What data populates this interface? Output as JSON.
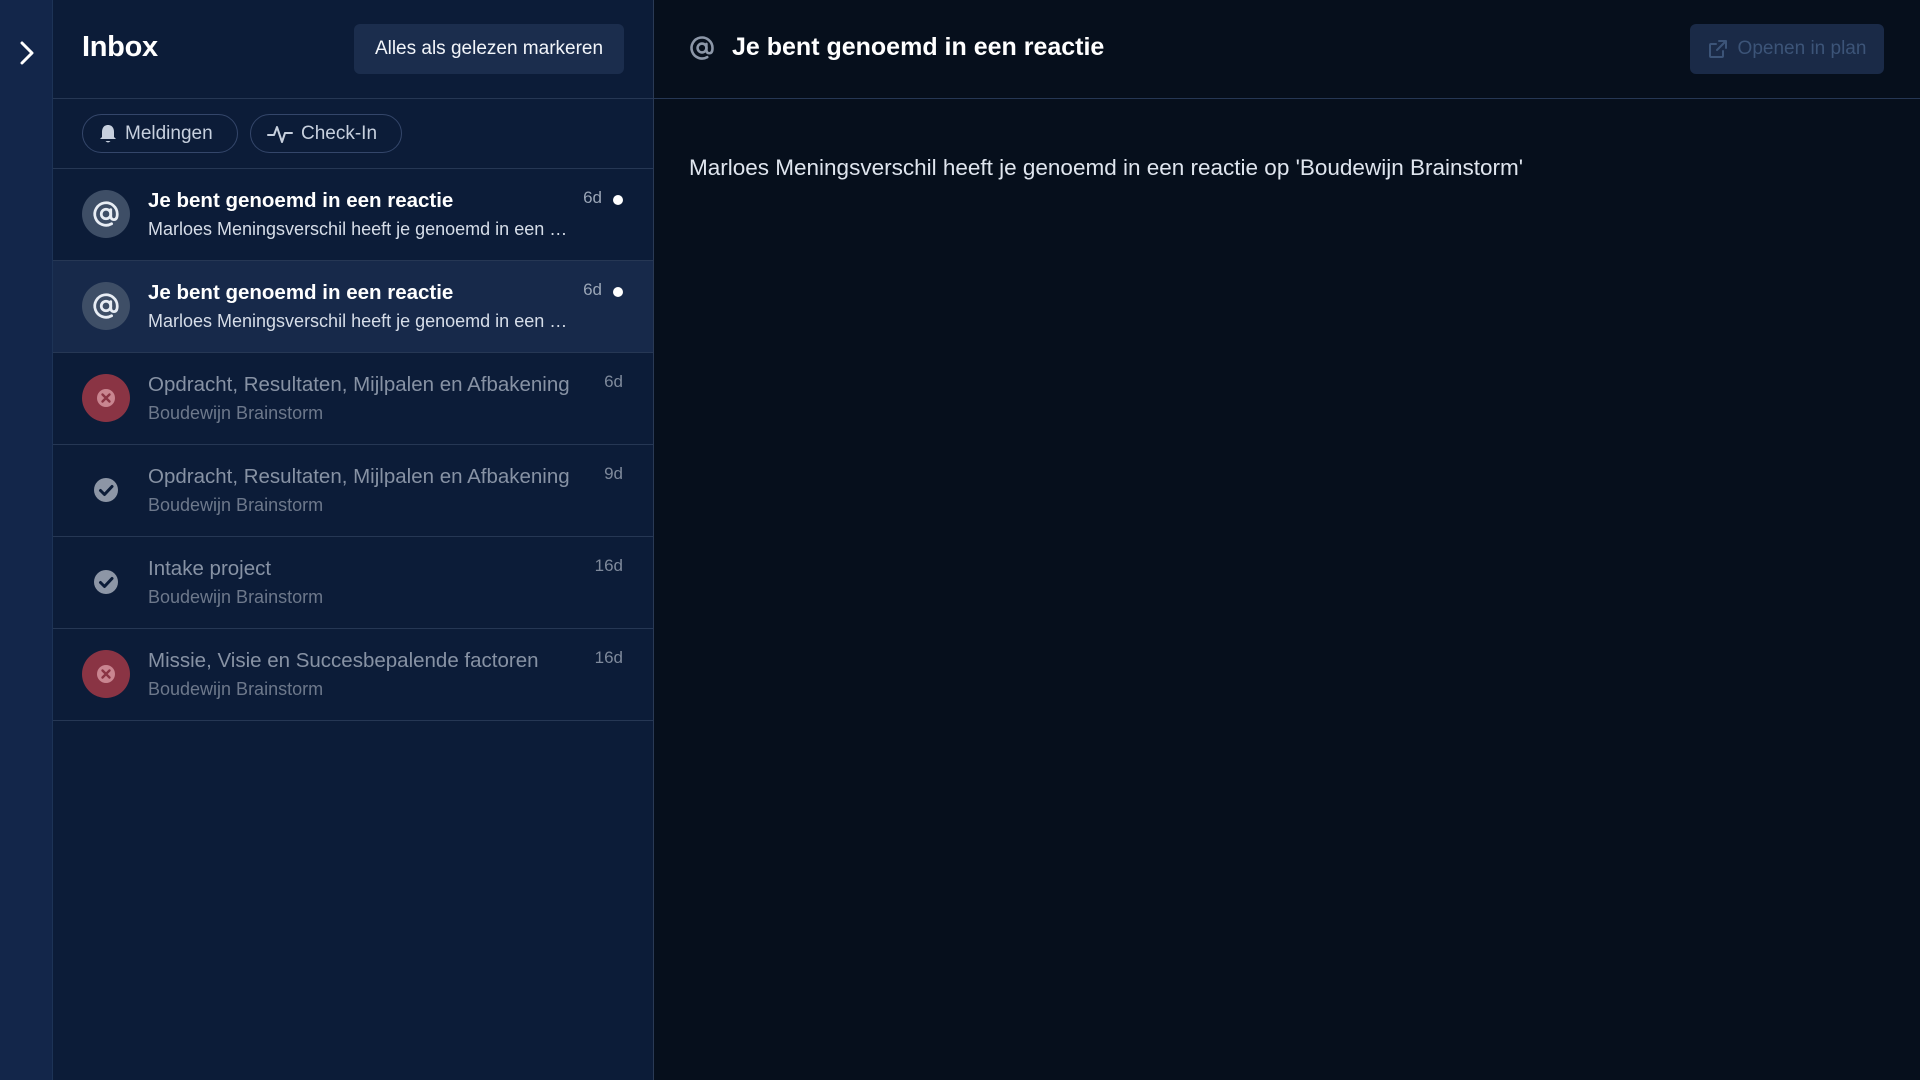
{
  "rail": {
    "toggle_icon": "chevron-right-icon"
  },
  "inbox": {
    "title": "Inbox",
    "mark_all_label": "Alles als gelezen markeren",
    "filters": [
      {
        "label": "Meldingen",
        "icon": "bell-icon"
      },
      {
        "label": "Check-In",
        "icon": "pulse-icon"
      }
    ],
    "items": [
      {
        "kind": "mention",
        "icon": "at-sign-icon",
        "title": "Je bent genoemd in een reactie",
        "subtitle": "Marloes Meningsverschil heeft je genoemd in een reactie op 'Boudewijn Brainstorm'",
        "time": "6d",
        "unread": true,
        "selected": false
      },
      {
        "kind": "mention",
        "icon": "at-sign-icon",
        "title": "Je bent genoemd in een reactie",
        "subtitle": "Marloes Meningsverschil heeft je genoemd in een reactie op 'Boudewijn Brainstorm'",
        "time": "6d",
        "unread": true,
        "selected": true
      },
      {
        "kind": "reject",
        "icon": "x-circle-icon",
        "title": "Opdracht, Resultaten, Mijlpalen en Afbakening",
        "subtitle": "Boudewijn Brainstorm",
        "time": "6d",
        "unread": false,
        "selected": false
      },
      {
        "kind": "check",
        "icon": "check-circle-icon",
        "title": "Opdracht, Resultaten, Mijlpalen en Afbakening",
        "subtitle": "Boudewijn Brainstorm",
        "time": "9d",
        "unread": false,
        "selected": false
      },
      {
        "kind": "check",
        "icon": "check-circle-icon",
        "title": "Intake project",
        "subtitle": "Boudewijn Brainstorm",
        "time": "16d",
        "unread": false,
        "selected": false
      },
      {
        "kind": "reject",
        "icon": "x-circle-icon",
        "title": "Missie, Visie en Succesbepalende factoren",
        "subtitle": "Boudewijn Brainstorm",
        "time": "16d",
        "unread": false,
        "selected": false
      }
    ]
  },
  "detail": {
    "icon": "at-sign-icon",
    "title": "Je bent genoemd in een reactie",
    "open_label": "Openen in plan",
    "open_icon": "external-link-icon",
    "body": "Marloes Meningsverschil heeft je genoemd in een reactie op 'Boudewijn Brainstorm'"
  },
  "colors": {
    "rail_bg": "#13264a",
    "inbox_bg": "#0c1c38",
    "selected_bg": "#17294a",
    "detail_bg": "#060f1c",
    "reject_red": "#8a3444",
    "mention_gray": "#3e4e66"
  }
}
